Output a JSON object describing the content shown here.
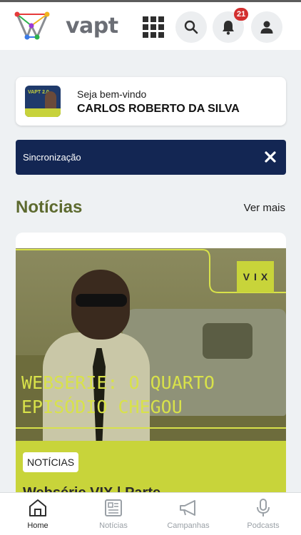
{
  "header": {
    "logo_text": "vapt",
    "notification_count": "21"
  },
  "welcome": {
    "greeting": "Seja bem-vindo",
    "user_name": "CARLOS ROBERTO DA SILVA",
    "thumb_label": "VAPT 2.0"
  },
  "sync": {
    "label": "Sincronização"
  },
  "news_section": {
    "title": "Notícias",
    "see_more": "Ver mais"
  },
  "news_card": {
    "brand_badge": "VIX",
    "headline_image_text": "WEBSÉRIE: O QUARTO EPISÓDIO CHEGOU",
    "tag": "NOTÍCIAS",
    "title_peek": "Websérie VIX | Parte"
  },
  "bottom_nav": {
    "items": [
      {
        "label": "Home",
        "icon": "home-icon",
        "active": true
      },
      {
        "label": "Notícias",
        "icon": "newspaper-icon",
        "active": false
      },
      {
        "label": "Campanhas",
        "icon": "megaphone-icon",
        "active": false
      },
      {
        "label": "Podcasts",
        "icon": "microphone-icon",
        "active": false
      }
    ]
  },
  "colors": {
    "navy": "#132653",
    "accent_lime": "#c8d43a",
    "section_title": "#5d6a2f",
    "badge_red": "#d32f2f"
  }
}
